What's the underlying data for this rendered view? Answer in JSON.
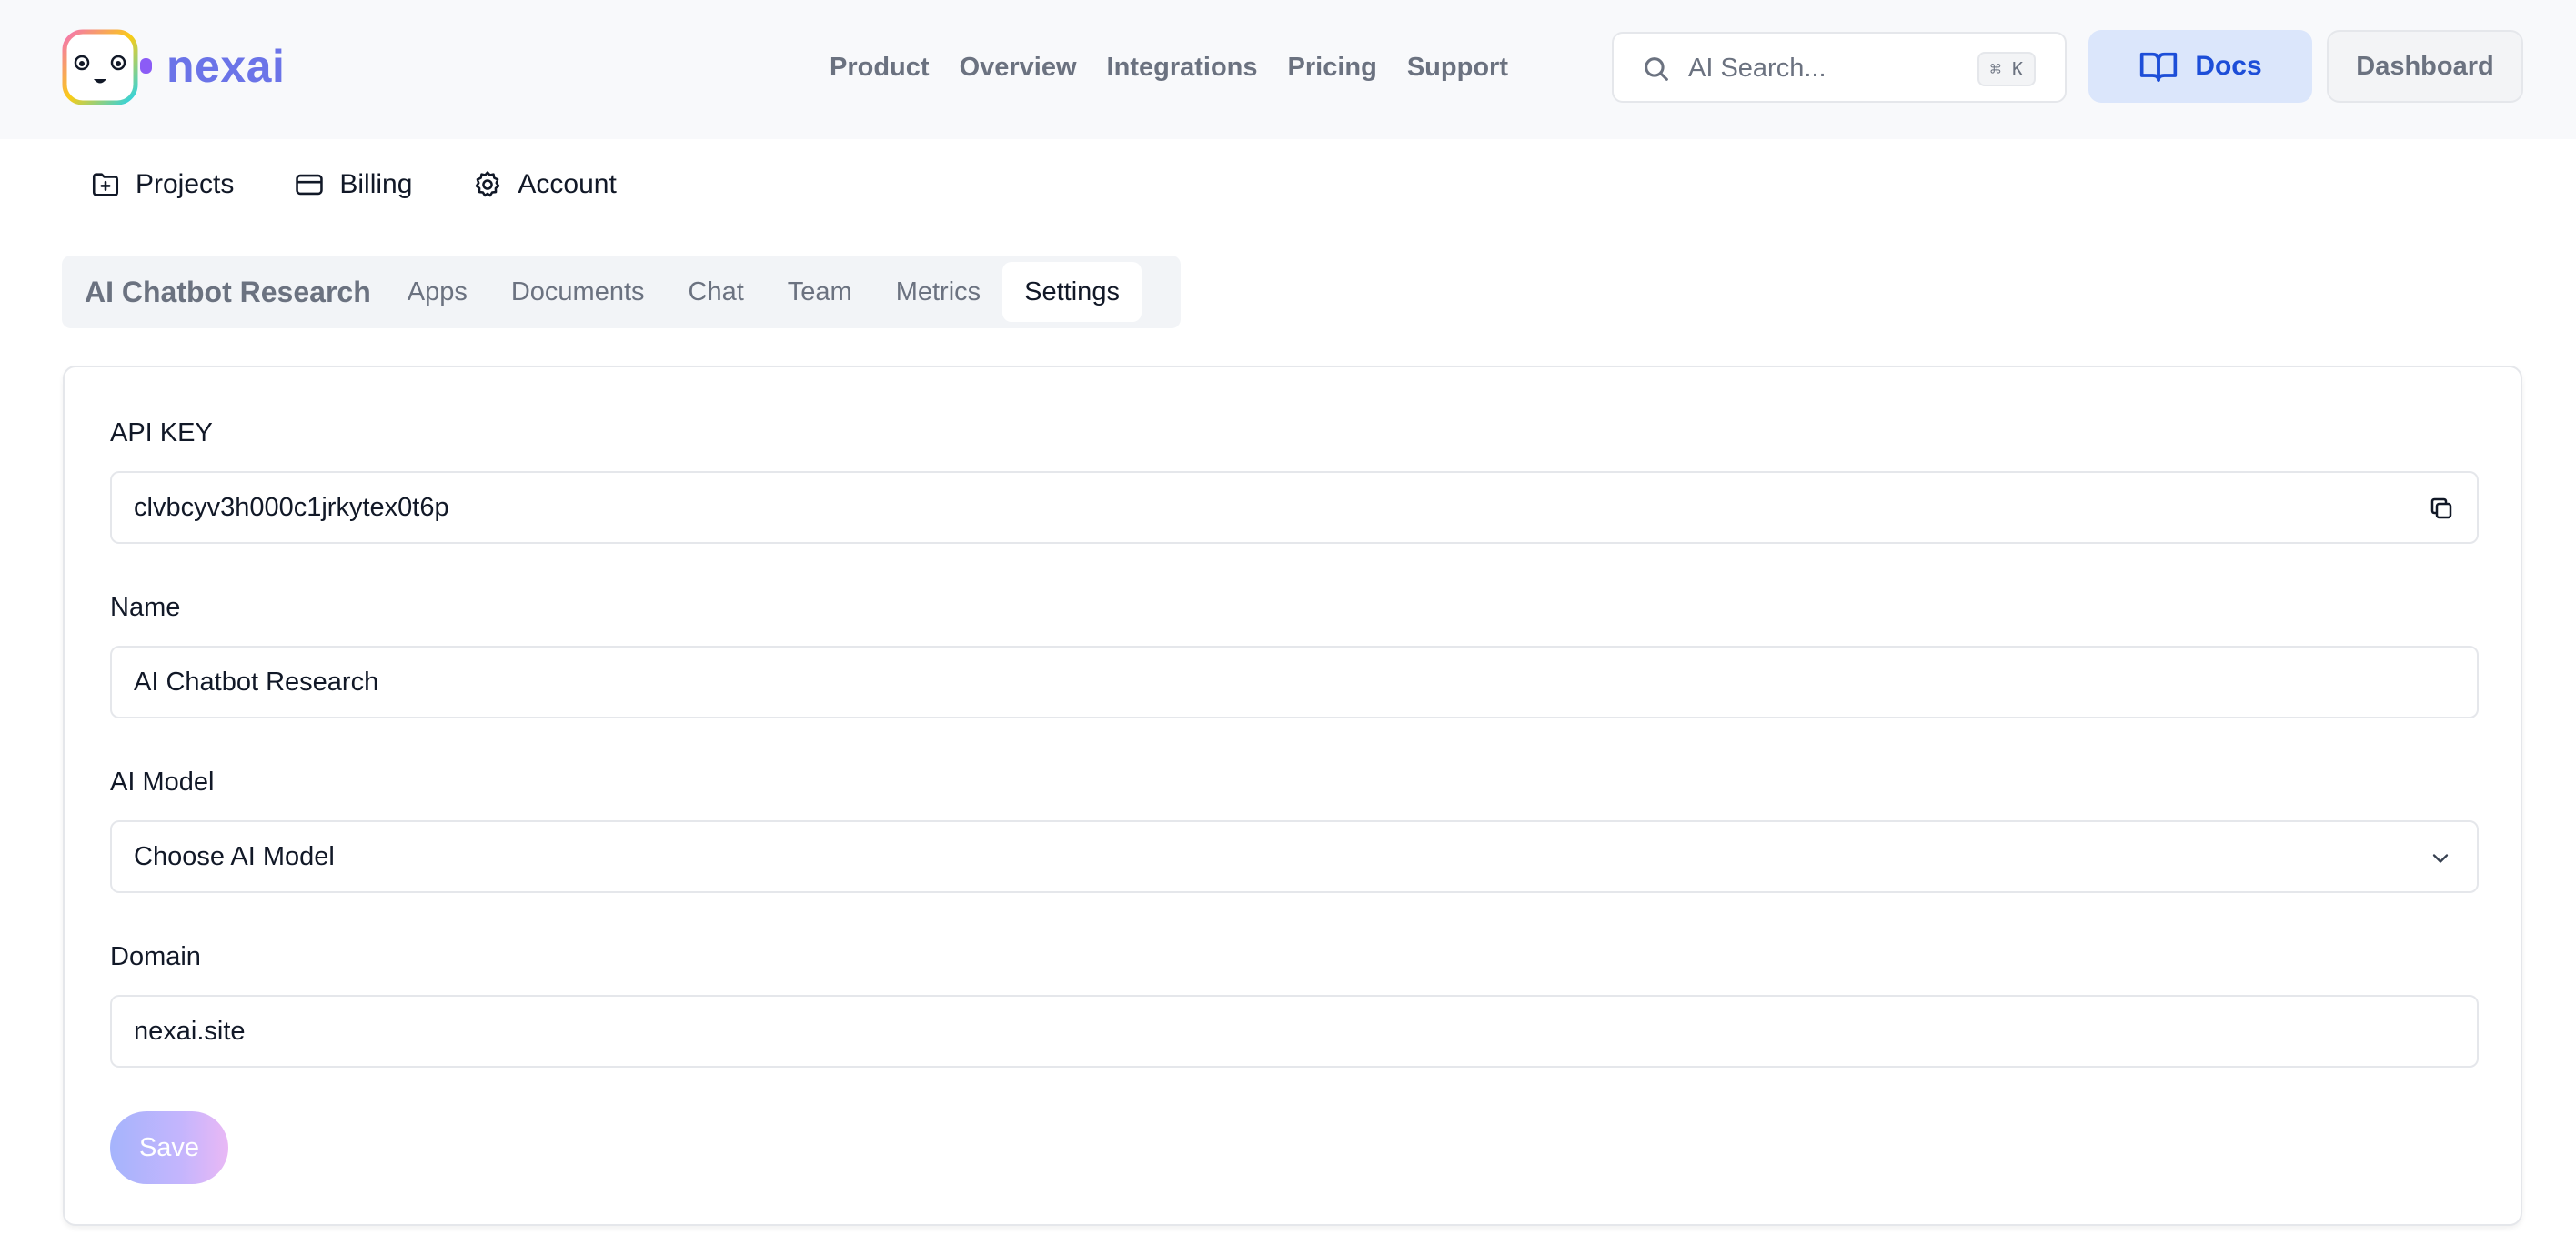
{
  "brand": {
    "name": "nexai",
    "accent": "#6b74e8"
  },
  "topnav": [
    "Product",
    "Overview",
    "Integrations",
    "Pricing",
    "Support"
  ],
  "search": {
    "placeholder": "AI Search...",
    "shortcut": "⌘ K",
    "icon": "search-icon"
  },
  "buttons": {
    "docs": "Docs",
    "dashboard": "Dashboard"
  },
  "subnav": [
    {
      "label": "Projects",
      "icon": "folder-plus-icon"
    },
    {
      "label": "Billing",
      "icon": "credit-card-icon"
    },
    {
      "label": "Account",
      "icon": "gear-icon"
    }
  ],
  "project": {
    "title": "AI Chatbot Research",
    "tabs": [
      "Apps",
      "Documents",
      "Chat",
      "Team",
      "Metrics",
      "Settings"
    ],
    "active_tab": "Settings"
  },
  "form": {
    "api_key_label": "API KEY",
    "api_key_value": "clvbcyv3h000c1jrkytex0t6p",
    "name_label": "Name",
    "name_value": "AI Chatbot Research",
    "model_label": "AI Model",
    "model_value": "Choose AI Model",
    "domain_label": "Domain",
    "domain_value": "nexai.site",
    "save_label": "Save"
  }
}
